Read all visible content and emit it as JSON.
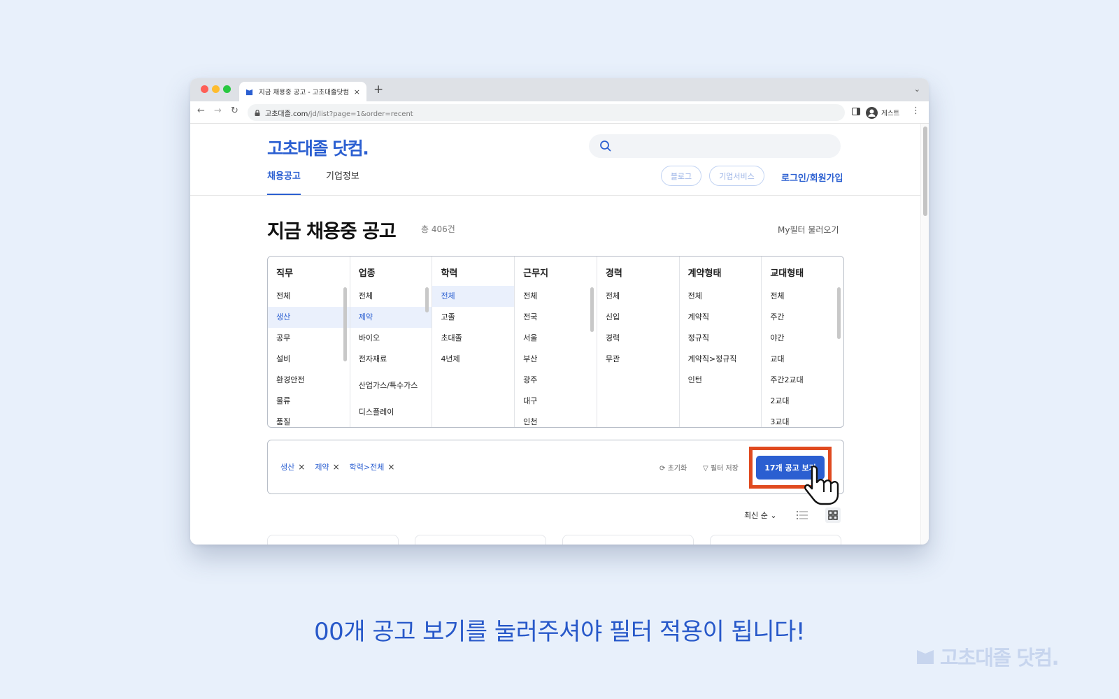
{
  "browser": {
    "tab_title": "지금 채용중 공고 - 고초대졸닷컴",
    "tab_close": "×",
    "new_tab": "+",
    "tab_menu": "⌄",
    "back": "←",
    "forward": "→",
    "reload": "↻",
    "url_host": "고초대졸.com",
    "url_path": "/jd/list?page=1&order=recent",
    "profile_name": "게스트",
    "menu": "⋮"
  },
  "site": {
    "logo": "고초대졸 닷컴.",
    "nav": {
      "active_tab": "채용공고",
      "tab2": "기업정보"
    },
    "header_links": {
      "blog": "블로그",
      "biz": "기업서비스",
      "login": "로그인/회원가입"
    }
  },
  "listing": {
    "title": "지금 채용중 공고",
    "total": "총 406건",
    "my_filter": "My필터 불러오기"
  },
  "filters": [
    {
      "header": "직무",
      "items": [
        "전체",
        "생산",
        "공무",
        "설비",
        "환경안전",
        "물류",
        "품질"
      ],
      "selected": 1
    },
    {
      "header": "업종",
      "items": [
        "전체",
        "제약",
        "바이오",
        "전자재료",
        "산업가스/특수가스",
        "디스플레이"
      ],
      "selected": 1
    },
    {
      "header": "학력",
      "items": [
        "전체",
        "고졸",
        "초대졸",
        "4년제"
      ],
      "selected": 0
    },
    {
      "header": "근무지",
      "items": [
        "전체",
        "전국",
        "서울",
        "부산",
        "광주",
        "대구",
        "인천"
      ],
      "selected": -1
    },
    {
      "header": "경력",
      "items": [
        "전체",
        "신입",
        "경력",
        "무관"
      ],
      "selected": -1
    },
    {
      "header": "계약형태",
      "items": [
        "전체",
        "계약직",
        "정규직",
        "계약직>정규직",
        "인턴"
      ],
      "selected": -1
    },
    {
      "header": "교대형태",
      "items": [
        "전체",
        "주간",
        "야간",
        "교대",
        "주간2교대",
        "2교대",
        "3교대"
      ],
      "selected": -1
    }
  ],
  "selection": {
    "chips": [
      "생산",
      "제약",
      "학력>전체"
    ],
    "chip_remove": "×",
    "reset": "초기화",
    "save": "필터 저장",
    "view_button": "17개 공고 보기"
  },
  "sort": {
    "label": "최신 순"
  },
  "caption": "00개 공고 보기를 눌러주셔야 필터 적용이 됩니다!",
  "watermark": "고초대졸 닷컴.",
  "colors": {
    "brand": "#2b5fd1",
    "highlight": "#e04a1f",
    "background": "#e8f0fb"
  }
}
